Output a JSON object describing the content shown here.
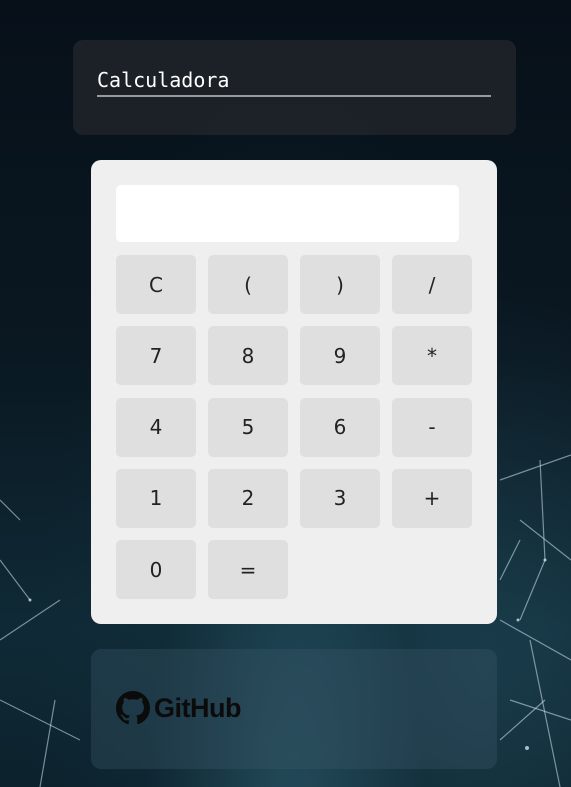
{
  "header": {
    "title": "Calculadora"
  },
  "calculator": {
    "display_value": "",
    "buttons": [
      {
        "label": "C",
        "name": "clear-button"
      },
      {
        "label": "(",
        "name": "open-paren-button"
      },
      {
        "label": ")",
        "name": "close-paren-button"
      },
      {
        "label": "/",
        "name": "divide-button"
      },
      {
        "label": "7",
        "name": "digit-7-button"
      },
      {
        "label": "8",
        "name": "digit-8-button"
      },
      {
        "label": "9",
        "name": "digit-9-button"
      },
      {
        "label": "*",
        "name": "multiply-button"
      },
      {
        "label": "4",
        "name": "digit-4-button"
      },
      {
        "label": "5",
        "name": "digit-5-button"
      },
      {
        "label": "6",
        "name": "digit-6-button"
      },
      {
        "label": "-",
        "name": "subtract-button"
      },
      {
        "label": "1",
        "name": "digit-1-button"
      },
      {
        "label": "2",
        "name": "digit-2-button"
      },
      {
        "label": "3",
        "name": "digit-3-button"
      },
      {
        "label": "+",
        "name": "add-button"
      },
      {
        "label": "0",
        "name": "digit-0-button"
      },
      {
        "label": "=",
        "name": "equals-button"
      }
    ]
  },
  "footer": {
    "github_label": "GitHub",
    "github_icon": "github-icon"
  },
  "colors": {
    "panel_bg": "#efefef",
    "button_bg": "#dfdfdf",
    "display_bg": "#ffffff"
  }
}
